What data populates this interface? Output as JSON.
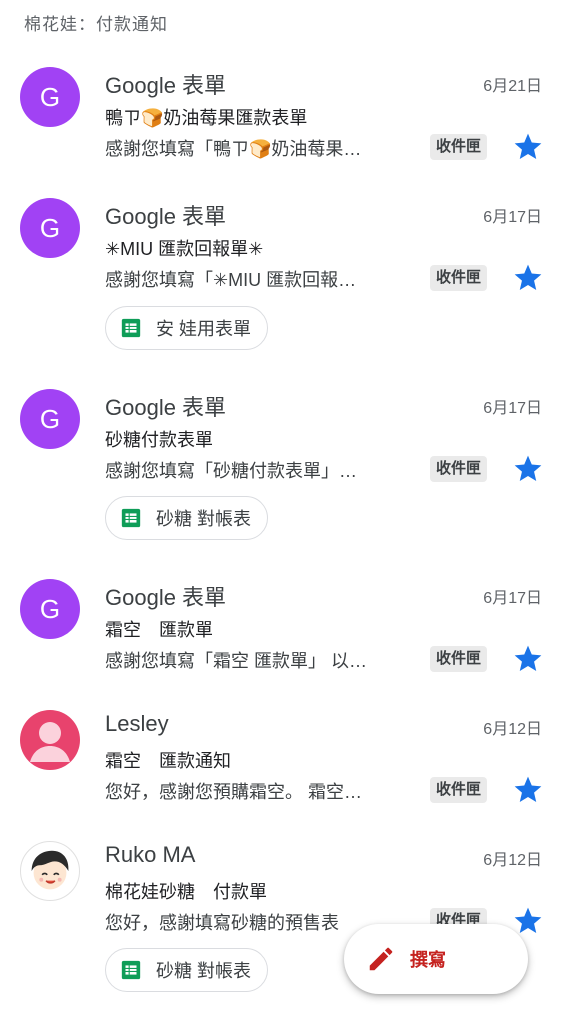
{
  "header": {
    "title": "棉花娃：付款通知"
  },
  "inbox_label": "收件匣",
  "emails": [
    {
      "sender": "Google 表單",
      "avatar_letter": "G",
      "date": "6月21日",
      "subject": "鴨ㄗ🍞奶油莓果匯款表單",
      "snippet": "感謝您填寫「鴨ㄗ🍞奶油莓果…",
      "label": "收件匣",
      "starred": true
    },
    {
      "sender": "Google 表單",
      "avatar_letter": "G",
      "date": "6月17日",
      "subject": "✳MIU 匯款回報單✳",
      "snippet": "感謝您填寫「✳MIU 匯款回報…",
      "label": "收件匣",
      "starred": true,
      "attachment": "安 娃用表單"
    },
    {
      "sender": "Google 表單",
      "avatar_letter": "G",
      "date": "6月17日",
      "subject": "砂糖付款表單",
      "snippet": "感謝您填寫「砂糖付款表單」…",
      "label": "收件匣",
      "starred": true,
      "attachment": "砂糖 對帳表"
    },
    {
      "sender": "Google 表單",
      "avatar_letter": "G",
      "date": "6月17日",
      "subject": "霜空　匯款單",
      "snippet": "感謝您填寫「霜空 匯款單」 以…",
      "label": "收件匣",
      "starred": true
    },
    {
      "sender": "Lesley",
      "date": "6月12日",
      "subject": "霜空　匯款通知",
      "snippet": "您好，感謝您預購霜空。 霜空…",
      "label": "收件匣",
      "starred": true
    },
    {
      "sender": "Ruko MA",
      "date": "6月12日",
      "subject": "棉花娃砂糖　付款單",
      "snippet": "您好，感謝填寫砂糖的預售表",
      "label": "收件匣",
      "starred": true,
      "attachment": "砂糖 對帳表"
    }
  ],
  "compose": {
    "label": "撰寫"
  },
  "colors": {
    "star": "#1a73e8",
    "avatar_purple": "#a142f4",
    "avatar_pink": "#e8436d",
    "sheets_green": "#0f9d58",
    "compose_red": "#c5221f"
  },
  "icons": {
    "star": "star-icon",
    "sheet": "google-sheets-icon",
    "pencil": "pencil-icon",
    "person": "person-icon"
  }
}
